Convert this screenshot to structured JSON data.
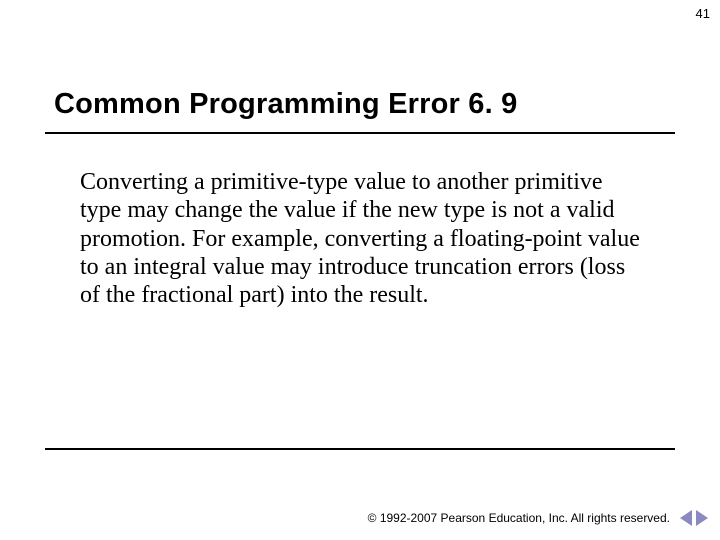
{
  "page_number": "41",
  "title": "Common Programming Error 6. 9",
  "body": "Converting a primitive-type value to another primitive type may change the value if the new type is not a valid promotion. For example, converting a floating-point value to an integral value may introduce truncation errors (loss of the fractional part) into the result.",
  "footer": {
    "copyright": "© 1992-2007 Pearson Education, Inc.  All rights reserved."
  }
}
